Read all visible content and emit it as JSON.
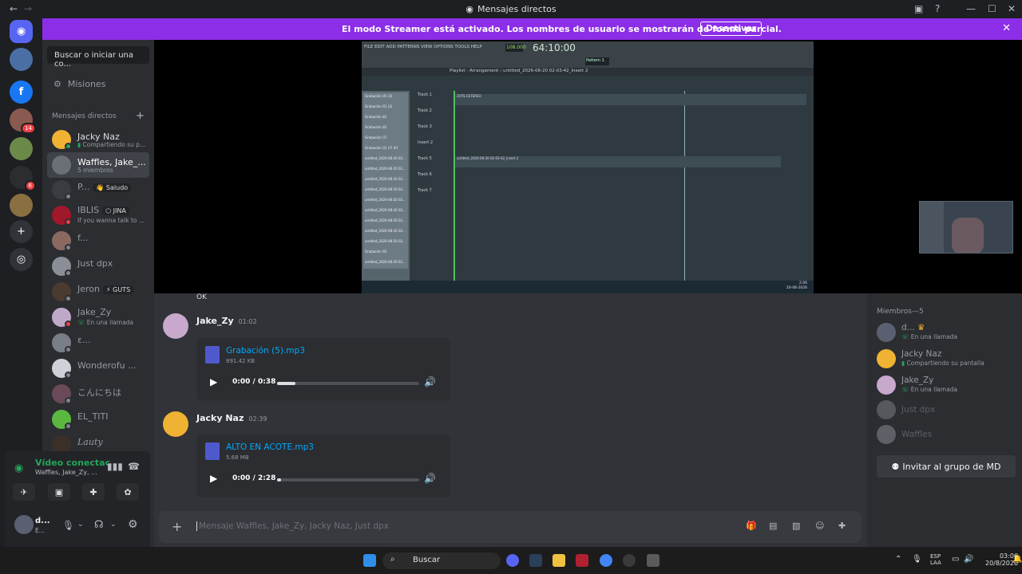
{
  "window": {
    "title": "Mensajes directos",
    "nav_back": "←",
    "nav_forward": "→",
    "minimize": "—",
    "maximize": "☐",
    "close": "✕",
    "inbox_icon": "inbox-icon",
    "help_icon": "help-icon"
  },
  "banner": {
    "text": "El modo Streamer está activado. Los nombres de usuario se mostrarán de forma parcial.",
    "button": "Desactivar"
  },
  "rail": {
    "badges": [
      "14",
      "6"
    ]
  },
  "sidebar": {
    "search_placeholder": "Buscar o iniciar una co...",
    "missions": "Misiones",
    "dm_header": "Mensajes directos",
    "add": "+",
    "dms": [
      {
        "name": "Jacky Naz",
        "sub": "Compartiendo su p...",
        "status": "online"
      },
      {
        "name": "Waffles, Jake_...",
        "sub": "5 miembros",
        "status": "group",
        "selected": true
      },
      {
        "name": "P...",
        "tag": "👋 Saludo",
        "status": "off"
      },
      {
        "name": "IBLIS",
        "tag": "⬡ JINA",
        "sub": "If you wanna talk to ...",
        "status": "dnd"
      },
      {
        "name": "f...",
        "status": "off"
      },
      {
        "name": "Just dpx",
        "status": "off"
      },
      {
        "name": "Jeron",
        "tag": "⚡ GUTS",
        "status": "off"
      },
      {
        "name": "Jake_Zy",
        "sub": "En una llamada",
        "status": "dnd"
      },
      {
        "name": "ε...",
        "status": "off"
      },
      {
        "name": "Wonderofu ...",
        "status": "off"
      },
      {
        "name": "こんにちは",
        "status": "off"
      },
      {
        "name": "EL_TITI",
        "status": "off"
      },
      {
        "name": "Lauty",
        "status": "off"
      }
    ],
    "voice": {
      "title": "Vídeo conectac",
      "sub": "Waffles, Jake_Zy, ..."
    },
    "user": {
      "name": "d...",
      "sub": "E..."
    }
  },
  "stream": {
    "fl": {
      "menu": "FILE EDIT ADD PATTERNS VIEW OPTIONS TOOLS HELP",
      "tempo": "108.000",
      "time": "64:10:00",
      "pattern": "Pattern 1",
      "playlist_title": "Playlist - Arrangement › untitled_2026-08-20 02-03-42_Insert 2",
      "clip1": "ZOTE ESTEREO",
      "clip2": "untitled_2026-08-20 02-03-42_Insert 2",
      "clip3": "untitled_2026-08-20 02-03-42_Insert 2",
      "channels": [
        "Grabación (4) (3)",
        "Grabación (5) (3)",
        "Grabación (6)",
        "Grabación (6)",
        "Grabación (7)",
        "Grabación (2) (7) #2",
        "untitled_2026-08-20 02...",
        "untitled_2026-08-20 02...",
        "untitled_2026-08-20 02...",
        "untitled_2026-08-20 02...",
        "untitled_2026-08-20 02...",
        "untitled_2026-08-20 02...",
        "untitled_2026-08-20 02...",
        "untitled_2026-08-20 02...",
        "untitled_2026-08-20 02...",
        "Grabación (9)",
        "untitled_2026-08-20 02...",
        "untitled_2026-08-20 02..."
      ],
      "tracks": [
        "Track 1",
        "Track 2",
        "Track 3",
        "Insert 2",
        "Track 5",
        "Track 6",
        "Track 7",
        "Track 8",
        "Track 9",
        "Track 10",
        "Track 11",
        "Track 12"
      ],
      "clock": "2:06",
      "date": "20-08-2026"
    }
  },
  "chat": {
    "prev": "OK",
    "messages": [
      {
        "author": "Jake_Zy",
        "time": "01:02",
        "file": "Grabación (5).mp3",
        "size": "891.42 KB",
        "elapsed": "0:00 / 0:38",
        "progress": 0.13
      },
      {
        "author": "Jacky Naz",
        "time": "02:39",
        "file": "ALTO EN ACOTE.mp3",
        "size": "5.68 MB",
        "elapsed": "0:00 / 2:28",
        "progress": 0.03
      }
    ],
    "composer_placeholder": "Mensaje Waffles, Jake_Zy, Jacky Naz, Just dpx"
  },
  "members": {
    "header": "Miembros—5",
    "list": [
      {
        "name": "d...",
        "sub": "En una llamada",
        "crown": true
      },
      {
        "name": "Jacky Naz",
        "sub": "Compartiendo su pantalla"
      },
      {
        "name": "Jake_Zy",
        "sub": "En una llamada"
      },
      {
        "name": "Just dpx",
        "sub": ""
      },
      {
        "name": "Waffles",
        "sub": ""
      }
    ],
    "invite": "Invitar al grupo de MD"
  },
  "taskbar": {
    "search": "Buscar",
    "lang": "ESP",
    "lang2": "LAA",
    "time": "03:06",
    "date": "20/8/2026"
  }
}
